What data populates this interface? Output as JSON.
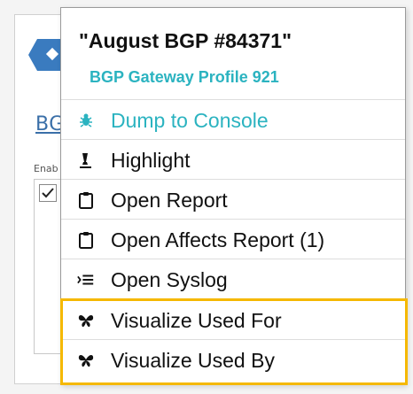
{
  "background": {
    "link_text": "BG",
    "label_text": "Enab"
  },
  "menu": {
    "title": "\"August BGP #84371\"",
    "subtitle": "BGP Gateway Profile 921",
    "items": [
      {
        "label": "Dump to Console",
        "icon": "bug-icon"
      },
      {
        "label": "Highlight",
        "icon": "highlighter-icon"
      },
      {
        "label": "Open Report",
        "icon": "clipboard-icon"
      },
      {
        "label": "Open Affects Report (1)",
        "icon": "clipboard-icon"
      },
      {
        "label": "Open Syslog",
        "icon": "list-icon"
      },
      {
        "label": "Visualize Used For",
        "icon": "butterfly-icon"
      },
      {
        "label": "Visualize Used By",
        "icon": "butterfly-icon"
      }
    ]
  },
  "colors": {
    "accent": "#2bb3c0",
    "highlight_border": "#f5b800",
    "logo_blue": "#3a7bbf"
  }
}
